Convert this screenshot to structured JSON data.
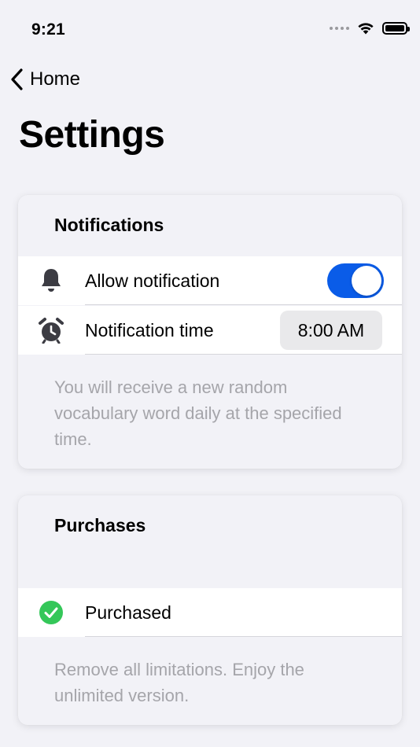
{
  "status_bar": {
    "time": "9:21"
  },
  "nav": {
    "back_label": "Home"
  },
  "page": {
    "title": "Settings"
  },
  "notifications": {
    "header": "Notifications",
    "allow_label": "Allow notification",
    "allow_enabled": true,
    "time_label": "Notification time",
    "time_value": "8:00 AM",
    "footnote": "You will receive a new random vocabulary word daily at the specified time."
  },
  "purchases": {
    "header": "Purchases",
    "status_label": "Purchased",
    "footnote": "Remove all limitations. Enjoy the unlimited version."
  },
  "colors": {
    "accent": "#0A5CE8",
    "success": "#34C759",
    "background": "#F2F2F7",
    "secondary_text": "#A5A5AA"
  },
  "icons": {
    "back": "chevron-left-icon",
    "notification": "bell-icon",
    "time": "alarm-clock-icon",
    "purchased": "checkmark-circle-icon"
  }
}
